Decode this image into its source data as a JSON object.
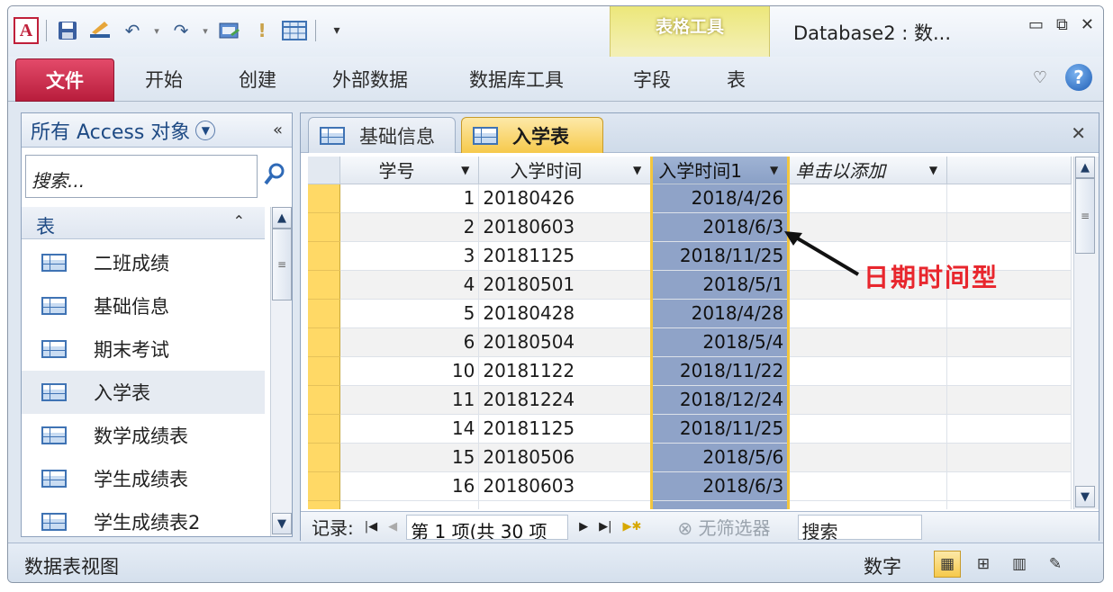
{
  "qat": {
    "app_icon": "A",
    "icons": [
      "save-icon",
      "design-icon",
      "undo-icon",
      "redo-icon",
      "datasheet-design-icon",
      "exclamation-icon",
      "table-icon",
      "customize-icon"
    ]
  },
  "contextual_group": "表格工具",
  "window_title": "Database2 : 数...",
  "window_buttons": {
    "minimize": "▭",
    "restore": "⧉",
    "close": "✕"
  },
  "ribbon": {
    "file": "文件",
    "tabs": [
      "开始",
      "创建",
      "外部数据",
      "数据库工具",
      "字段",
      "表"
    ],
    "help": "?",
    "heart": "♡"
  },
  "nav": {
    "title": "所有 Access 对象",
    "collapse": "«",
    "search_placeholder": "搜索...",
    "group_label": "表",
    "group_toggle": "⌃",
    "items": [
      {
        "label": "二班成绩"
      },
      {
        "label": "基础信息"
      },
      {
        "label": "期末考试"
      },
      {
        "label": "入学表",
        "selected": true
      },
      {
        "label": "数学成绩表"
      },
      {
        "label": "学生成绩表"
      },
      {
        "label": "学生成绩表2"
      }
    ]
  },
  "doc_tabs": [
    {
      "label": "基础信息",
      "active": false
    },
    {
      "label": "入学表",
      "active": true
    }
  ],
  "grid": {
    "columns": [
      "学号",
      "入学时间",
      "入学时间1",
      "单击以添加"
    ],
    "rows": [
      {
        "id": "1",
        "time": "20180426",
        "date": "2018/4/26"
      },
      {
        "id": "2",
        "time": "20180603",
        "date": "2018/6/3"
      },
      {
        "id": "3",
        "time": "20181125",
        "date": "2018/11/25"
      },
      {
        "id": "4",
        "time": "20180501",
        "date": "2018/5/1"
      },
      {
        "id": "5",
        "time": "20180428",
        "date": "2018/4/28"
      },
      {
        "id": "6",
        "time": "20180504",
        "date": "2018/5/4"
      },
      {
        "id": "10",
        "time": "20181122",
        "date": "2018/11/22"
      },
      {
        "id": "11",
        "time": "20181224",
        "date": "2018/12/24"
      },
      {
        "id": "14",
        "time": "20181125",
        "date": "2018/11/25"
      },
      {
        "id": "15",
        "time": "20180506",
        "date": "2018/5/6"
      },
      {
        "id": "16",
        "time": "20180603",
        "date": "2018/6/3"
      }
    ]
  },
  "recnav": {
    "label": "记录:",
    "position": "第 1 项(共 30 项",
    "filter": "无筛选器",
    "search": "搜索"
  },
  "annotation": "日期时间型",
  "status": {
    "view_name": "数据表视图",
    "numlock": "数字"
  }
}
